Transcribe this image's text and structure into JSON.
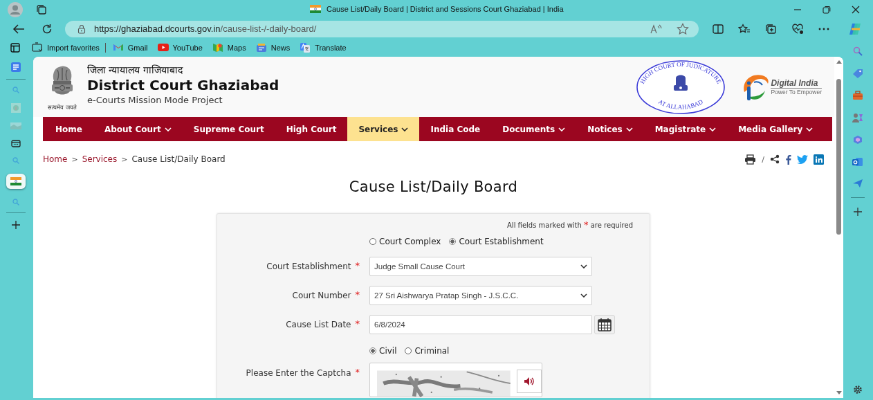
{
  "browser": {
    "tab_title": "Cause List/Daily Board | District and Sessions Court Ghaziabad | India",
    "url": {
      "host": "https://ghaziabad.dcourts.gov.in",
      "path": "/cause-list-/-daily-board/"
    },
    "bookmarks": [
      {
        "label": "Import favorites",
        "kind": "import"
      },
      {
        "label": "Gmail",
        "kind": "gmail"
      },
      {
        "label": "YouTube",
        "kind": "youtube"
      },
      {
        "label": "Maps",
        "kind": "maps"
      },
      {
        "label": "News",
        "kind": "news"
      },
      {
        "label": "Translate",
        "kind": "translate"
      }
    ]
  },
  "header": {
    "hindi_title": "जिला न्यायालय गाजियाबाद",
    "title": "District Court Ghaziabad",
    "subtitle": "e-Courts Mission Mode Project",
    "motto": "सत्यमेव जयते",
    "seal_top": "HIGH COURT OF JUDICATURE",
    "seal_bottom": "AT ALLAHABAD",
    "logo_title": "Digital India",
    "logo_tagline": "Power To Empower"
  },
  "nav": [
    {
      "label": "Home",
      "dropdown": false,
      "selected": false
    },
    {
      "label": "About Court",
      "dropdown": true,
      "selected": false
    },
    {
      "label": "Supreme Court",
      "dropdown": false,
      "selected": false
    },
    {
      "label": "High Court",
      "dropdown": false,
      "selected": false
    },
    {
      "label": "Services",
      "dropdown": true,
      "selected": true
    },
    {
      "label": "India Code",
      "dropdown": false,
      "selected": false
    },
    {
      "label": "Documents",
      "dropdown": true,
      "selected": false
    },
    {
      "label": "Notices",
      "dropdown": true,
      "selected": false
    },
    {
      "label": "Magistrate",
      "dropdown": true,
      "selected": false
    },
    {
      "label": "Media Gallery",
      "dropdown": true,
      "selected": false
    }
  ],
  "breadcrumb": [
    {
      "label": "Home",
      "link": true
    },
    {
      "label": "Services",
      "link": true
    },
    {
      "label": "Cause List/Daily Board",
      "link": false
    }
  ],
  "breadcrumb_separator": ">",
  "share_separator": "/",
  "heading": "Cause List/Daily Board",
  "form": {
    "required_note": {
      "before": "All fields marked with",
      "mark": "*",
      "after": "are required"
    },
    "scope_options": [
      {
        "label": "Court Complex",
        "selected": false
      },
      {
        "label": "Court Establishment",
        "selected": true
      }
    ],
    "fields": [
      {
        "label": "Court Establishment",
        "mark": "*",
        "kind": "select",
        "value": "Judge Small Cause Court"
      },
      {
        "label": "Court Number",
        "mark": "*",
        "kind": "select",
        "value": "27 Sri Aishwarya Pratap Singh - J.S.C.C."
      },
      {
        "label": "Cause List Date",
        "mark": "*",
        "kind": "date",
        "value": "6/8/2024"
      }
    ],
    "case_types": [
      {
        "label": "Civil",
        "selected": true
      },
      {
        "label": "Criminal",
        "selected": false
      }
    ],
    "captcha": {
      "label": "Please Enter the Captcha",
      "mark": "*"
    }
  }
}
